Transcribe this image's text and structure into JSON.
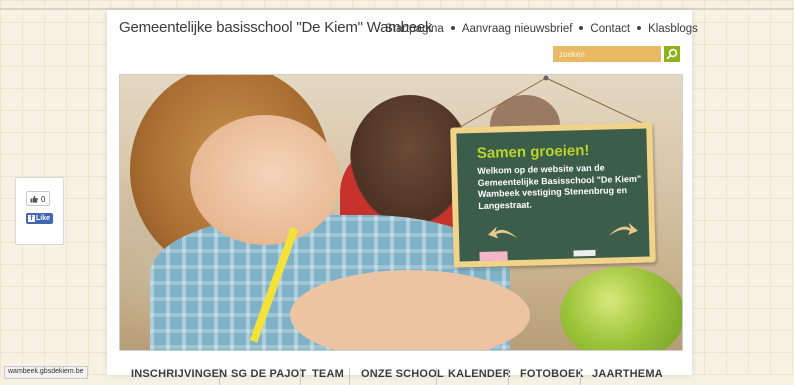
{
  "site": {
    "title": "Gemeentelijke basisschool \"De Kiem\" Wambeek"
  },
  "nav": {
    "items": [
      "Startpagina",
      "Aanvraag nieuwsbrief",
      "Contact",
      "Klasblogs"
    ]
  },
  "search": {
    "placeholder": "zoeken"
  },
  "hero": {
    "board_title": "Samen groeien!",
    "board_text": "Welkom op de website van de Gemeentelijke Basisschool \"De Kiem\" Wambeek vestiging Stenenbrug en Langestraat."
  },
  "facebook": {
    "count": "0",
    "like_label": "Like"
  },
  "menu": {
    "items": [
      "INSCHRIJVINGEN",
      "SG DE PAJOT",
      "TEAM",
      "ONZE SCHOOL",
      "KALENDER",
      "FOTOBOEK",
      "JAARTHEMA"
    ]
  },
  "statusbar": {
    "url": "wambeek.gbsdekiem.be"
  },
  "colors": {
    "search_bg": "#e9b964",
    "search_button": "#8cb31c",
    "board_title": "#b8d32a",
    "chalkboard": "#3d5d4b",
    "facebook_blue": "#4267b2"
  },
  "icons": {
    "search": "search-icon",
    "like_thumb": "thumbs-up-icon",
    "facebook": "facebook-icon"
  }
}
